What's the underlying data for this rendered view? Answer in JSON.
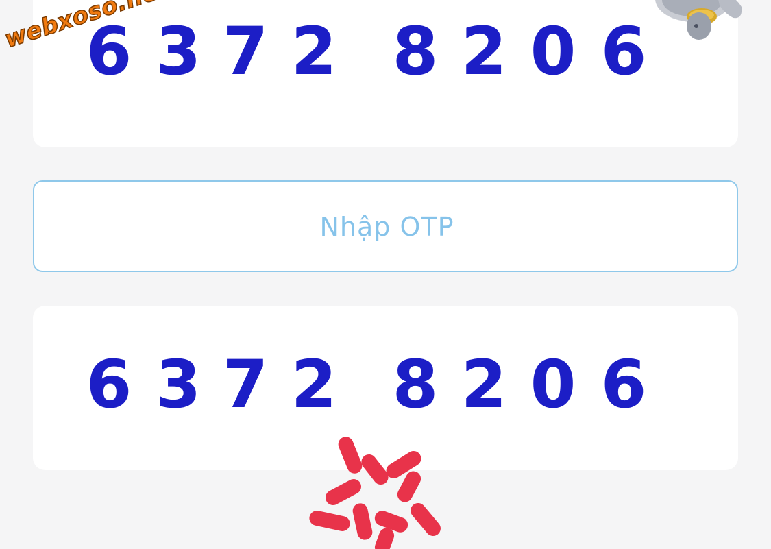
{
  "watermark": "webxoso.net",
  "code_top": {
    "digits": [
      "6",
      "3",
      "7",
      "2",
      "8",
      "2",
      "0",
      "6"
    ]
  },
  "otp_field": {
    "placeholder": "Nhập OTP",
    "value": ""
  },
  "code_bottom": {
    "digits": [
      "6",
      "3",
      "7",
      "2",
      "8",
      "2",
      "0",
      "6"
    ]
  },
  "colors": {
    "background": "#f5f5f6",
    "card": "#ffffff",
    "digits": "#1c1ec6",
    "input_border": "#8fc8ea",
    "placeholder": "#86c3ea",
    "watermark": "#f07a10",
    "annotation": "#e8334a"
  },
  "icons": {
    "corner": "mascot-character-icon",
    "annotation": "red-sparkle-marks-icon"
  }
}
